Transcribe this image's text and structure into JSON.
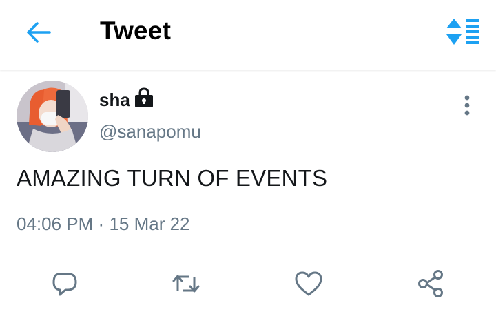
{
  "header": {
    "title": "Tweet",
    "back_icon": "arrow-left-icon",
    "sort_icon": "sort-toggle-icon",
    "accent": "#1da1f2"
  },
  "tweet": {
    "display_name": "sha",
    "handle": "@sanapomu",
    "protected_icon": "lock-icon",
    "text": "AMAZING TURN OF EVENTS",
    "time": "04:06 PM",
    "separator": "·",
    "date": "15 Mar 22",
    "more_icon": "more-vertical-icon"
  },
  "actions": [
    {
      "icon": "reply-icon"
    },
    {
      "icon": "retweet-icon"
    },
    {
      "icon": "like-icon"
    },
    {
      "icon": "share-icon"
    }
  ],
  "colors": {
    "text": "#14171a",
    "secondary": "#657786",
    "icon": "#657786"
  }
}
